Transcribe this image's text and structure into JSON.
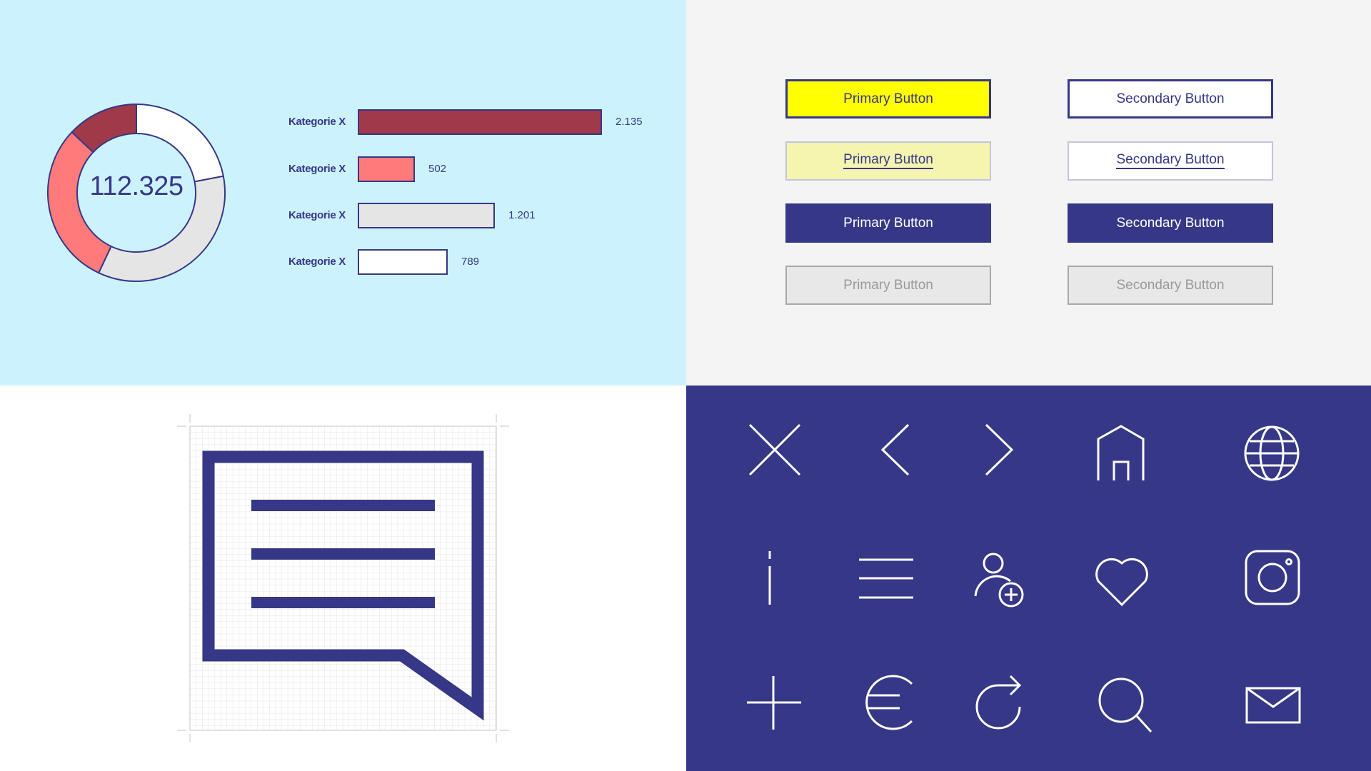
{
  "chart_data": [
    {
      "type": "pie",
      "variant": "donut",
      "center_label": "112.325",
      "slices": [
        {
          "name": "segment-1",
          "percent": 22,
          "color": "#ffffff"
        },
        {
          "name": "segment-2",
          "percent": 35,
          "color": "#e5e5e5"
        },
        {
          "name": "segment-3",
          "percent": 30,
          "color": "#ff7b7b"
        },
        {
          "name": "segment-4",
          "percent": 13,
          "color": "#a03a4a"
        }
      ]
    },
    {
      "type": "bar",
      "orientation": "horizontal",
      "categories": [
        "Kategorie X",
        "Kategorie X",
        "Kategorie X",
        "Kategorie X"
      ],
      "values": [
        2135,
        502,
        1201,
        789
      ],
      "value_labels": [
        "2.135",
        "502",
        "1.201",
        "789"
      ],
      "colors": [
        "#a03a4a",
        "#ff7b7b",
        "#e5e5e5",
        "#ffffff"
      ],
      "xlim": [
        0,
        2135
      ]
    }
  ],
  "buttons": {
    "primary": [
      "Primary Button",
      "Primary Button",
      "Primary Button",
      "Primary Button"
    ],
    "secondary": [
      "Secondary Button",
      "Secondary Button",
      "Secondary Button",
      "Secondary Button"
    ],
    "states": [
      "default",
      "hover",
      "active",
      "disabled"
    ]
  },
  "grid_icon": {
    "name": "chat-message-icon"
  },
  "icons": [
    "close-icon",
    "chevron-left-icon",
    "chevron-right-icon",
    "home-icon",
    "globe-icon",
    "info-icon",
    "menu-icon",
    "add-user-icon",
    "heart-icon",
    "instagram-icon",
    "plus-icon",
    "euro-icon",
    "refresh-icon",
    "search-icon",
    "mail-icon"
  ],
  "colors": {
    "brand": "#373787",
    "chart_bg": "#ccf3fd",
    "button_bg": "#f4f4f4",
    "accent_yellow": "#ffff00"
  }
}
